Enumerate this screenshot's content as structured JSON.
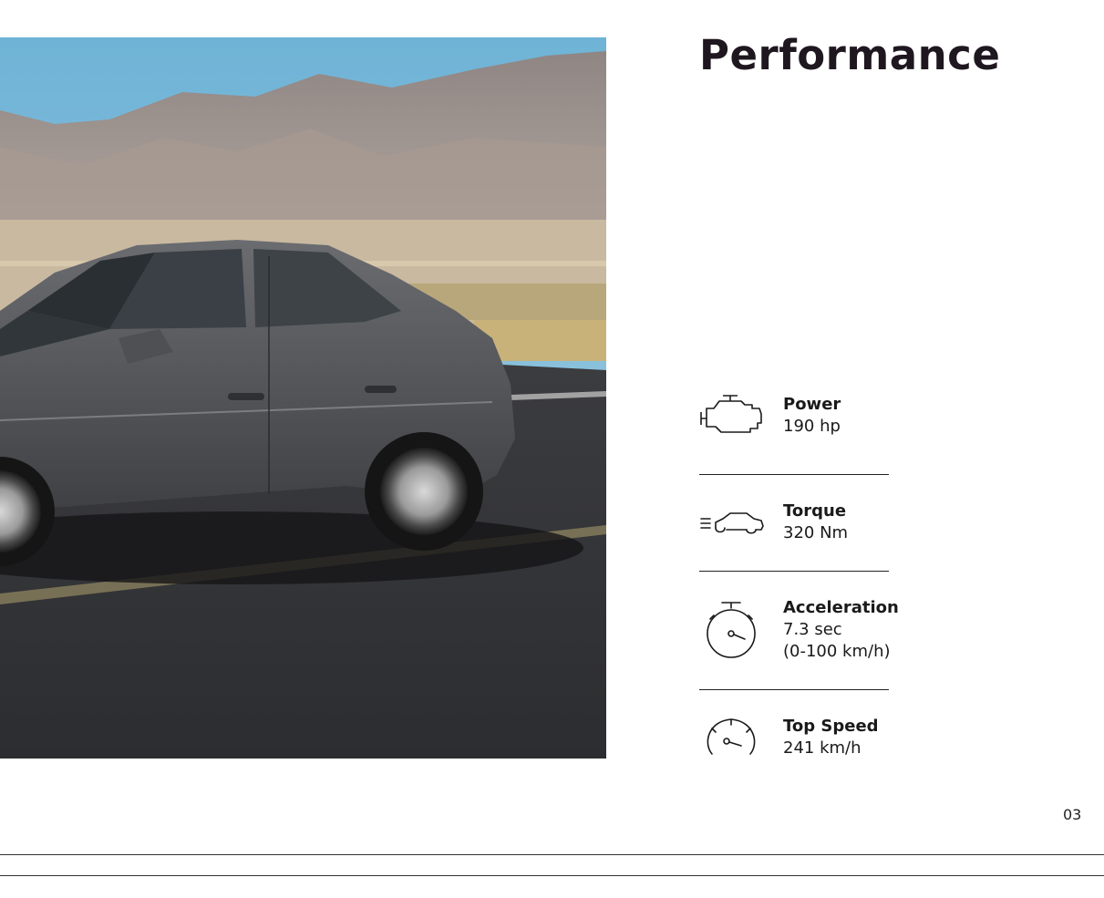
{
  "page": {
    "title": "Performance",
    "page_number": "03"
  },
  "specs": [
    {
      "label": "Power",
      "value": "190 hp",
      "icon": "engine-icon"
    },
    {
      "label": "Torque",
      "value": "320 Nm",
      "icon": "car-speed-icon"
    },
    {
      "label": "Acceleration",
      "value": "7.3 sec",
      "value2": "(0-100 km/h)",
      "icon": "stopwatch-icon"
    },
    {
      "label": "Top Speed",
      "value": "241 km/h",
      "icon": "speedometer-icon"
    }
  ],
  "photo": {
    "subject": "car-photo"
  }
}
